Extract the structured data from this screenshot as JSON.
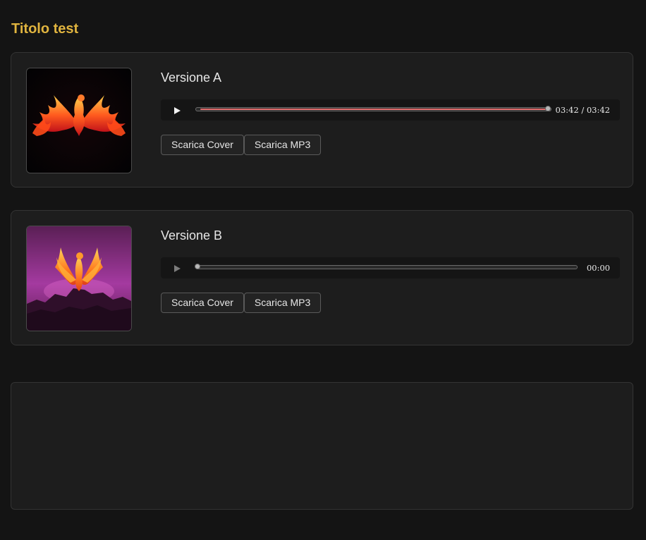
{
  "page": {
    "title": "Titolo test",
    "accent_color": "#e0b43f"
  },
  "versions": [
    {
      "title": "Versione A",
      "cover": "phoenix-fire-black-background",
      "time_display": "03:42 / 03:42",
      "progress": 1.0,
      "download_cover_label": "Scarica Cover",
      "download_mp3_label": "Scarica MP3"
    },
    {
      "title": "Versione B",
      "cover": "phoenix-rising-purple-sky",
      "time_display": "00:00",
      "progress": 0.0,
      "download_cover_label": "Scarica Cover",
      "download_mp3_label": "Scarica MP3"
    }
  ],
  "icons": {
    "play": "play-icon"
  }
}
